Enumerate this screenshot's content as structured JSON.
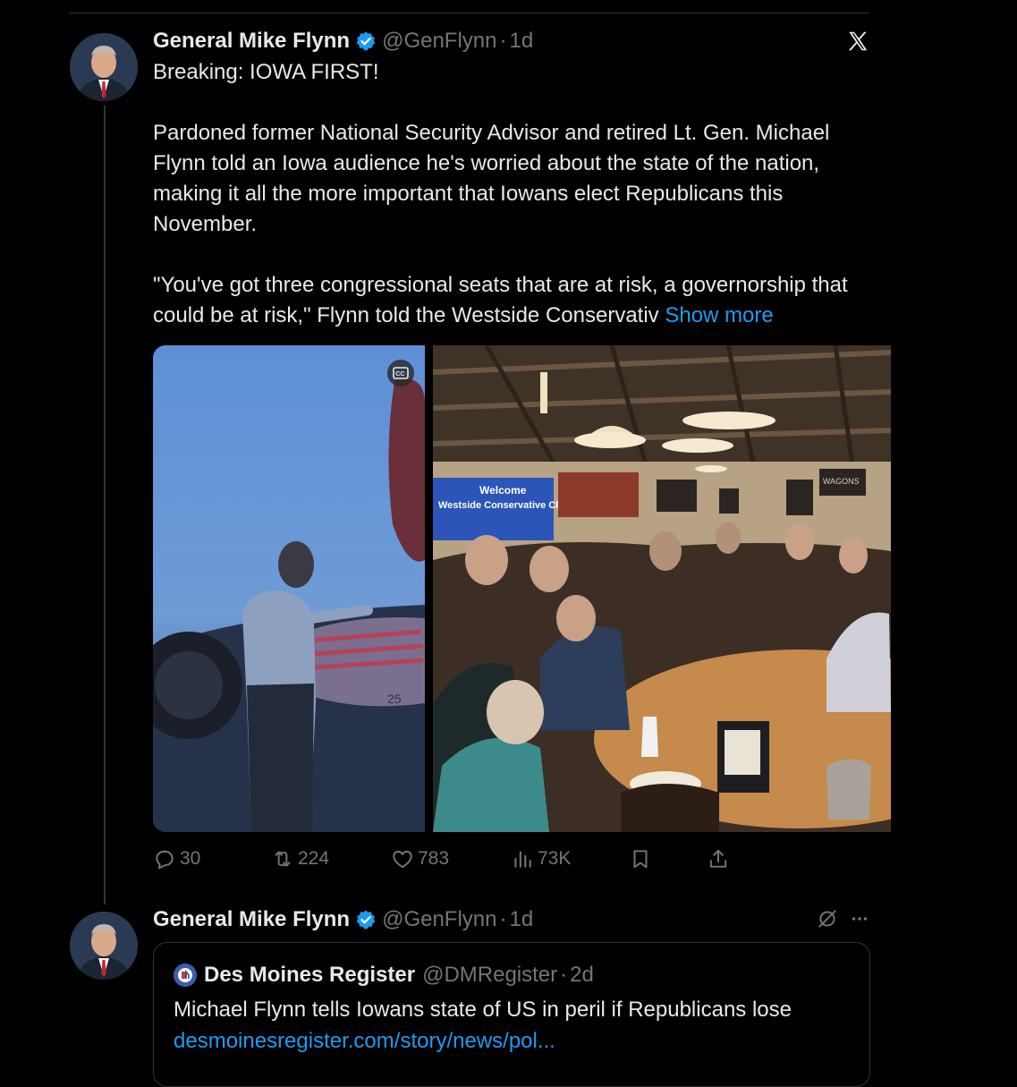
{
  "tweet1": {
    "author_name": "General Mike Flynn",
    "handle": "@GenFlynn",
    "separator": "·",
    "time": "1d",
    "paragraphs": [
      "Breaking: IOWA FIRST!",
      "Pardoned former National Security Advisor and retired Lt. Gen. Michael Flynn told an Iowa audience he's worried about the state of the nation, making it all the more important that Iowans elect Republicans this November.",
      "\"You've got three congressional seats that are at risk, a governorship that could be at risk,\" Flynn told the Westside Conservativ"
    ],
    "show_more": "Show more",
    "video_banner_line1": "Welcome",
    "video_banner_line2": "Westside Conservative Club",
    "photo_sign_text": "WAGONS",
    "video_number": "25",
    "actions": {
      "replies": "30",
      "reposts": "224",
      "likes": "783",
      "views": "73K"
    }
  },
  "tweet2": {
    "author_name": "General Mike Flynn",
    "handle": "@GenFlynn",
    "separator": "·",
    "time": "1d",
    "quote": {
      "source_name": "Des Moines Register",
      "source_handle": "@DMRegister",
      "separator": "·",
      "source_time": "2d",
      "text": "Michael Flynn tells Iowans state of US in peril if Republicans lose",
      "link": "desmoinesregister.com/story/news/pol..."
    }
  },
  "colors": {
    "background": "#000000",
    "text": "#e7e9ea",
    "muted": "#71767b",
    "accent": "#1d9bf0",
    "border": "#2f3336"
  }
}
